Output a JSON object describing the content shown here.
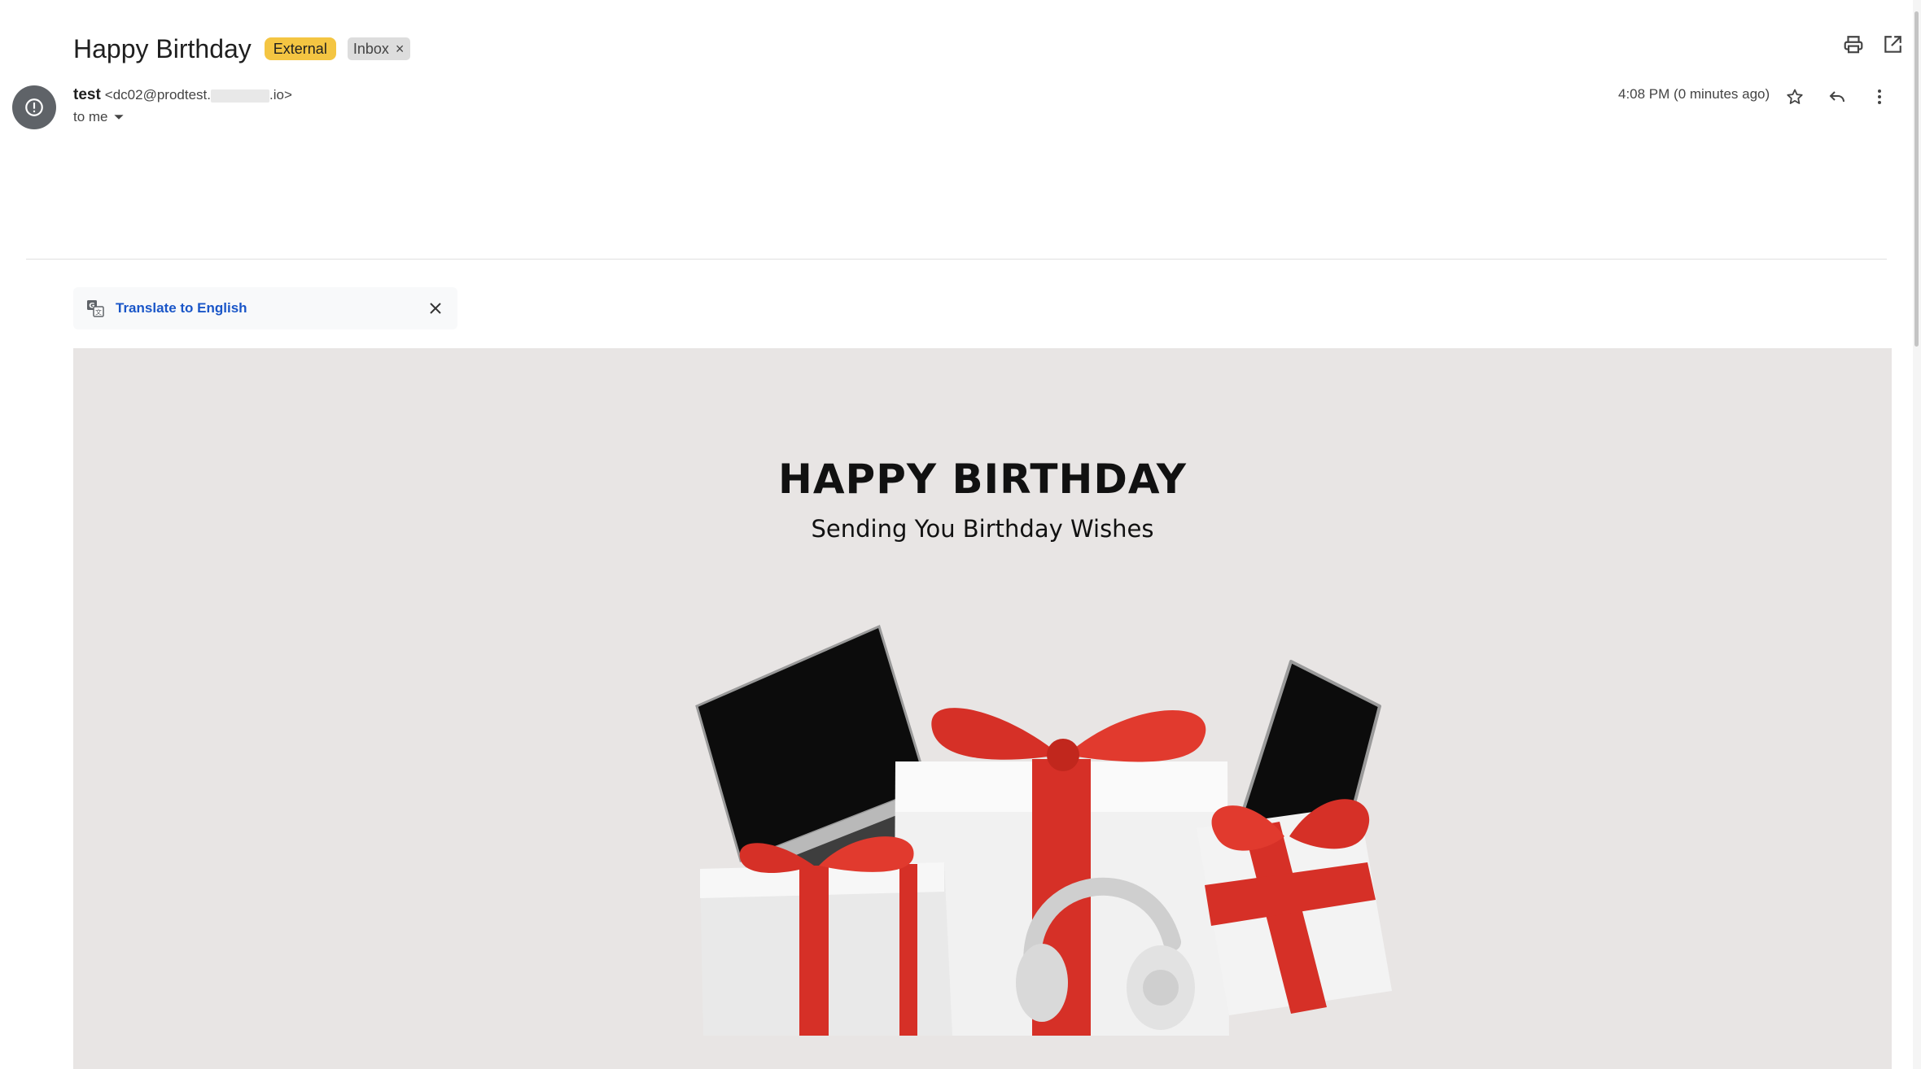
{
  "header": {
    "subject": "Happy Birthday",
    "badges": {
      "external": "External",
      "inbox": "Inbox",
      "inbox_remove": "×"
    }
  },
  "toolbar": {
    "icons": [
      "print-icon",
      "open-in-new-window-icon"
    ]
  },
  "message": {
    "sender_name": "test",
    "sender_email_prefix": "<dc02@prodtest.",
    "sender_email_suffix": ".io>",
    "recipient": "to me",
    "time": "4:08 PM (0 minutes ago)",
    "action_icons": [
      "star-icon",
      "reply-icon",
      "more-vert-icon"
    ]
  },
  "translate": {
    "link": "Translate to English"
  },
  "body": {
    "headline": "HAPPY BIRTHDAY",
    "subline": "Sending You Birthday Wishes",
    "image": "gifts-laptop-phone-headphones"
  },
  "colors": {
    "external_badge": "#f4c542",
    "inbox_badge": "#dddddd",
    "link": "#1a56c8",
    "body_background": "#e8e5e4",
    "ribbon": "#d63027"
  }
}
